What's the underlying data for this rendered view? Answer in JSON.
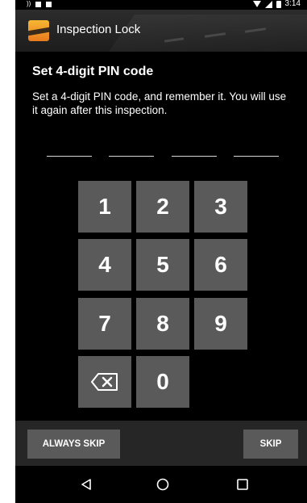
{
  "app": {
    "title": "Inspection Lock",
    "icon": "app-logo-icon"
  },
  "status_bar": {
    "time": "3:14",
    "icons": [
      "notification-icon",
      "notification-icon",
      "wifi-icon",
      "signal-icon",
      "battery-icon"
    ]
  },
  "content": {
    "heading": "Set 4-digit PIN code",
    "description": "Set a 4-digit PIN code, and remember it. You will use it again after this inspection."
  },
  "pin": {
    "digits_entered": 0,
    "slots": 4
  },
  "keypad": {
    "keys": [
      "1",
      "2",
      "3",
      "4",
      "5",
      "6",
      "7",
      "8",
      "9",
      "0"
    ],
    "backspace_icon": "backspace-icon"
  },
  "actions": {
    "always_skip": "ALWAYS SKIP",
    "skip": "SKIP"
  },
  "nav": {
    "icons": [
      "back-icon",
      "home-icon",
      "recents-icon"
    ]
  },
  "colors": {
    "background": "#000000",
    "key": "#5a5a5a",
    "action_bar": "#262626",
    "text": "#ffffff"
  }
}
